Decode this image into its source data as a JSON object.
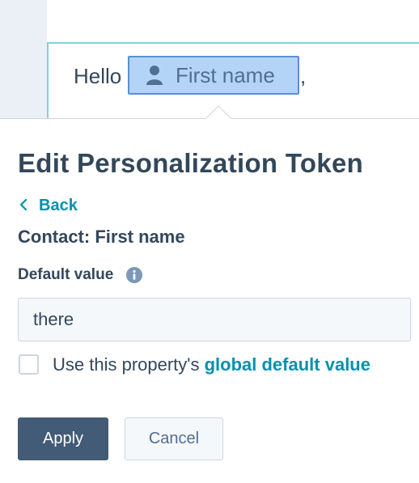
{
  "editor": {
    "greeting": "Hello",
    "token_label": "First name",
    "trailing": ","
  },
  "popover": {
    "title": "Edit Personalization Token",
    "back_label": "Back",
    "contact_label": "Contact: First name",
    "default_value_label": "Default value",
    "default_value": "there",
    "checkbox_checked": false,
    "checkbox_text": "Use this property's ",
    "checkbox_link": "global default value",
    "apply_label": "Apply",
    "cancel_label": "Cancel"
  },
  "icons": {
    "token": "person-icon",
    "back": "chevron-left-icon",
    "info": "info-icon"
  },
  "colors": {
    "accent": "#0091ae",
    "primary_button": "#425b76",
    "text": "#33475b",
    "token_bg": "#b3d4f7",
    "token_border": "#5b8ed6"
  }
}
